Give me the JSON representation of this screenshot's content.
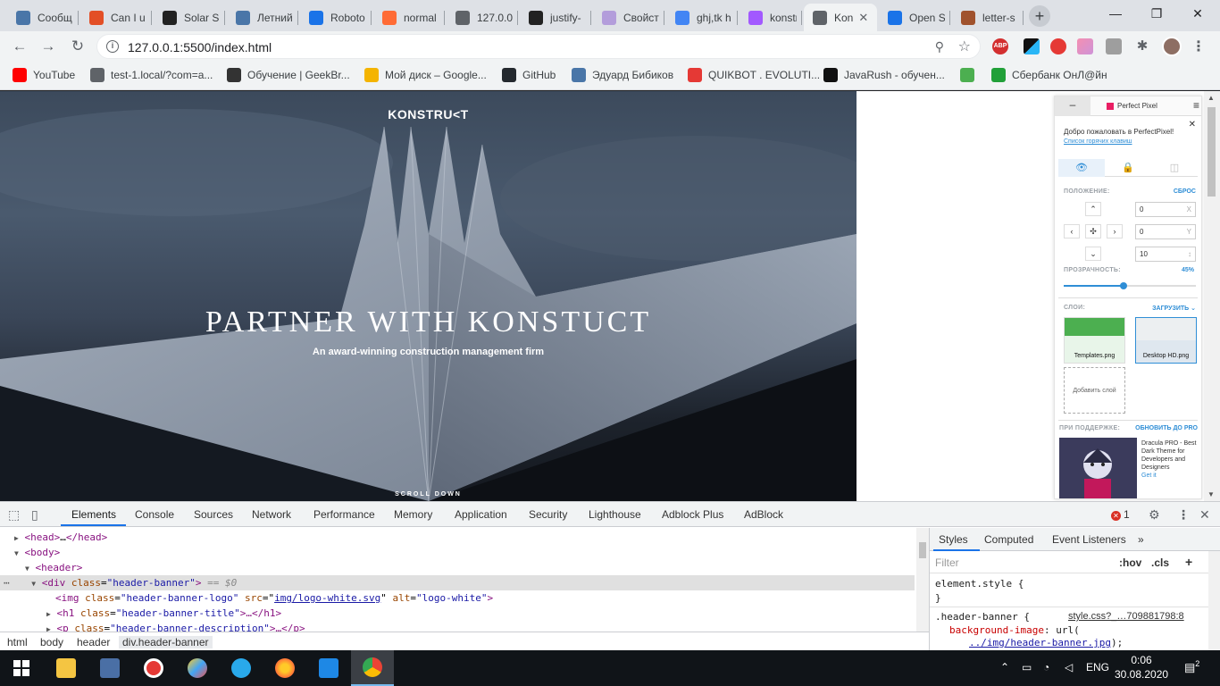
{
  "browser": {
    "tabs": [
      {
        "title": "Сообщ",
        "color": "#4a76a8",
        "glyph": "chat-icon"
      },
      {
        "title": "Can I u",
        "color": "#e34f26",
        "glyph": "html5-icon"
      },
      {
        "title": "Solar S",
        "color": "#222222",
        "glyph": "solar-icon"
      },
      {
        "title": "Летний",
        "color": "#4a76a8",
        "glyph": "vk-icon"
      },
      {
        "title": "Roboto",
        "color": "#1a73e8",
        "glyph": "font-icon"
      },
      {
        "title": "normal",
        "color": "#ff6b35",
        "glyph": "bracket-icon"
      },
      {
        "title": "127.0.0",
        "color": "#5f6368",
        "glyph": "globe-icon"
      },
      {
        "title": "justify-",
        "color": "#222222",
        "glyph": "question-icon"
      },
      {
        "title": "Свойст",
        "color": "#b39ddb",
        "glyph": "circle-icon"
      },
      {
        "title": "ghj,tk h",
        "color": "#4285f4",
        "glyph": "google-icon"
      },
      {
        "title": "konstru",
        "color": "#a259ff",
        "glyph": "figma-icon"
      },
      {
        "title": "Kon",
        "color": "#5f6368",
        "glyph": "globe-icon",
        "active": true
      },
      {
        "title": "Open S",
        "color": "#1a73e8",
        "glyph": "font-icon"
      },
      {
        "title": "letter-s",
        "color": "#a0522d",
        "glyph": "squares-icon"
      }
    ],
    "url": "127.0.0.1:5500/index.html",
    "bookmarks": [
      {
        "label": "YouTube",
        "color": "#ff0000"
      },
      {
        "label": "test-1.local/?com=a...",
        "color": "#5f6368"
      },
      {
        "label": "Обучение | GeekBr...",
        "color": "#333333"
      },
      {
        "label": "Мой диск – Google...",
        "color": "#f4b400"
      },
      {
        "label": "GitHub",
        "color": "#24292e"
      },
      {
        "label": "Эдуард Бибиков",
        "color": "#4a76a8"
      },
      {
        "label": "QUIKBOT . EVOLUTI...",
        "color": "#e53935"
      },
      {
        "label": "JavaRush - обучен...",
        "color": "#111111"
      },
      {
        "label": "",
        "color": "#4caf50"
      },
      {
        "label": "Сбербанк ОнЛ@йн",
        "color": "#21a038"
      }
    ]
  },
  "page": {
    "logo": "KONSTRU<T",
    "title": "PARTNER WITH KONSTUCT",
    "description": "An award-winning construction management firm",
    "scroll": "SCROLL DOWN"
  },
  "perfect_pixel": {
    "minimize": "–",
    "brand": "Perfect Pixel",
    "welcome": "Добро пожаловать в PerfectPixel!",
    "hotkeys": "Список горячих клавиш",
    "position_label": "ПОЛОЖЕНИЕ:",
    "reset": "СБРОС",
    "x_value": "0",
    "x_axis": "X",
    "y_value": "0",
    "y_axis": "Y",
    "z_value": "10",
    "z_axis": "↕",
    "opacity_label": "ПРОЗРАЧНОСТЬ:",
    "opacity_value": "45%",
    "opacity_fraction": 0.45,
    "layers_label": "СЛОИ:",
    "upload": "ЗАГРУЗИТЬ ⌄",
    "layer1": "Templates.png",
    "layer2": "Desktop HD.png",
    "add_layer": "Добавить слой",
    "support_label": "ПРИ ПОДДЕРЖКЕ:",
    "upgrade": "ОБНОВИТЬ ДО PRO",
    "ad_text": "Dracula PRO - Best Dark Theme for Developers and Designers",
    "ad_get": "Get it"
  },
  "devtools": {
    "tabs": [
      "Elements",
      "Console",
      "Sources",
      "Network",
      "Performance",
      "Memory",
      "Application",
      "Security",
      "Lighthouse",
      "Adblock Plus",
      "AdBlock"
    ],
    "error_count": "1",
    "dom": {
      "head_open": "<head>",
      "head_ellipsis": "…",
      "head_close": "</head>",
      "body": "<body>",
      "header": "<header>",
      "div_open": "<div",
      "div_class_attr": "class",
      "div_class_val": "\"header-banner\"",
      "div_close": ">",
      "div_dollar": "== $0",
      "img_open": "<img",
      "img_class_attr": "class",
      "img_class_val": "\"header-banner-logo\"",
      "img_src_attr": "src",
      "img_src_val": "img/logo-white.svg",
      "img_alt_attr": "alt",
      "img_alt_val": "\"logo-white\"",
      "img_close": ">",
      "h1_open": "<h1",
      "h1_class_attr": "class",
      "h1_class_val": "\"header-banner-title\"",
      "h1_close": ">…</h1>",
      "p_open": "<p",
      "p_class_attr": "class",
      "p_class_val": "\"header-banner-description\"",
      "p_close": ">…</p>"
    },
    "crumbs": [
      "html",
      "body",
      "header",
      "div.header-banner"
    ],
    "styles_tabs": [
      "Styles",
      "Computed",
      "Event Listeners",
      "»"
    ],
    "filter_placeholder": "Filter",
    "hov": ":hov",
    "cls": ".cls",
    "plus": "+",
    "element_style": "element.style {",
    "element_style_close": "}",
    "rule_selector": ".header-banner {",
    "rule_source": "style.css?_…709881798:8",
    "rule_prop": "background-image",
    "rule_value_prefix": ": url(",
    "rule_url": "../img/header-banner.jpg",
    "rule_value_suffix": ");"
  },
  "taskbar": {
    "lang": "ENG",
    "time": "0:06",
    "date": "30.08.2020",
    "notifications": "2"
  }
}
